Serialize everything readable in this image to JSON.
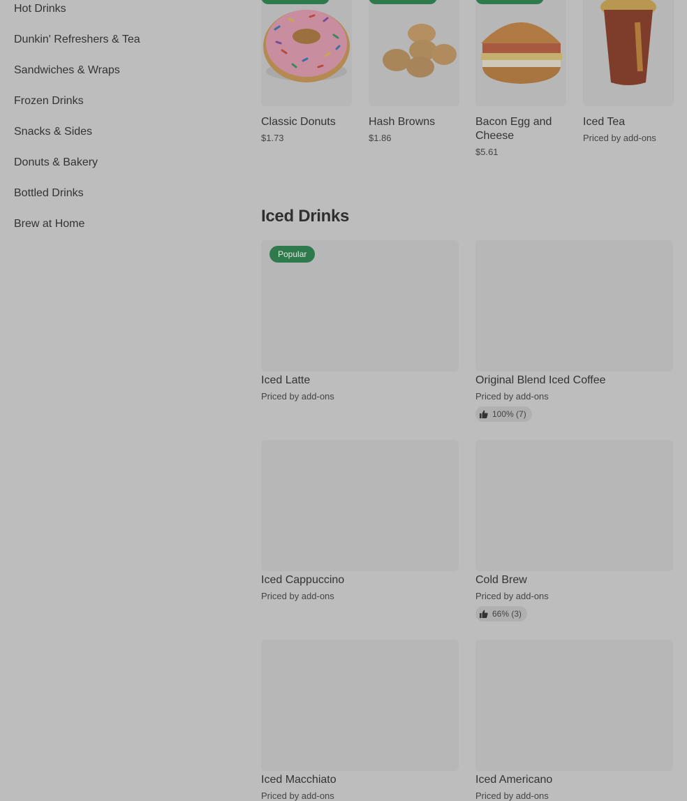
{
  "sidebar": {
    "categories": [
      "Hot Drinks",
      "Dunkin' Refreshers & Tea",
      "Sandwiches & Wraps",
      "Frozen Drinks",
      "Snacks & Sides",
      "Donuts & Bakery",
      "Bottled Drinks",
      "Brew at Home"
    ]
  },
  "featured": [
    {
      "name": "Classic Donuts",
      "price": "$1.73"
    },
    {
      "name": "Hash Browns",
      "price": "$1.86"
    },
    {
      "name": "Bacon Egg and Cheese",
      "price": "$5.61"
    },
    {
      "name": "Iced Tea",
      "price": "Priced by add-ons"
    }
  ],
  "iced_section": {
    "title": "Iced Drinks",
    "items": [
      {
        "name": "Iced Latte",
        "price": "Priced by add-ons",
        "badge": "Popular"
      },
      {
        "name": "Original Blend Iced Coffee",
        "price": "Priced by add-ons",
        "rating": "100% (7)"
      },
      {
        "name": "Iced Cappuccino",
        "price": "Priced by add-ons"
      },
      {
        "name": "Cold Brew",
        "price": "Priced by add-ons",
        "rating": "66% (3)"
      },
      {
        "name": "Iced Macchiato",
        "price": "Priced by add-ons"
      },
      {
        "name": "Iced Americano",
        "price": "Priced by add-ons"
      }
    ]
  },
  "colors": {
    "overlay": "#bdbdbd",
    "badge": "#2f7a4c",
    "thumb": "#b7b7b7"
  },
  "icons": {
    "rating": "thumbs-up-icon"
  }
}
